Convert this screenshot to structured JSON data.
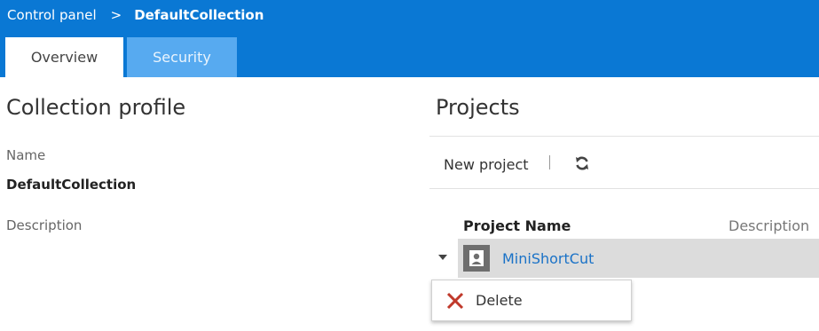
{
  "breadcrumb": {
    "root": "Control panel",
    "separator": ">",
    "current": "DefaultCollection"
  },
  "tabs": [
    {
      "label": "Overview",
      "active": true
    },
    {
      "label": "Security",
      "active": false
    }
  ],
  "collection_profile": {
    "title": "Collection profile",
    "name_label": "Name",
    "name_value": "DefaultCollection",
    "description_label": "Description"
  },
  "projects": {
    "title": "Projects",
    "toolbar": {
      "new_project_label": "New project",
      "refresh_icon": "refresh-icon"
    },
    "columns": {
      "name": "Project Name",
      "description": "Description"
    },
    "rows": [
      {
        "name": "MiniShortCut",
        "icon": "project-avatar-icon"
      }
    ]
  },
  "context_menu": {
    "items": [
      {
        "label": "Delete",
        "icon": "delete-x-icon"
      }
    ]
  },
  "colors": {
    "header_bg": "#0a78d4",
    "inactive_tab_bg": "#57aaf0",
    "link": "#1a72c7",
    "selected_row_bg": "#dcdcdc",
    "delete_icon": "#c0392b"
  }
}
